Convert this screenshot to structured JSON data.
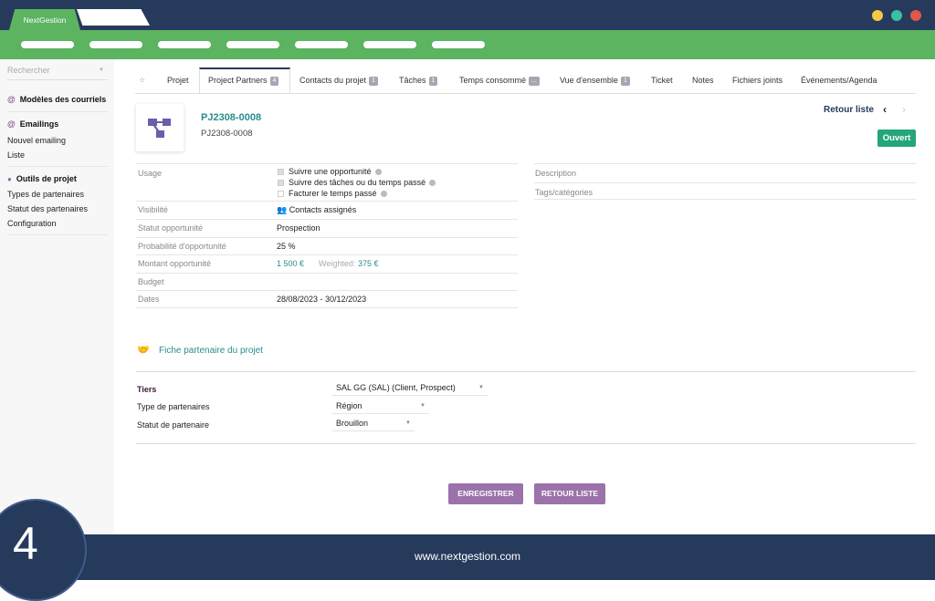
{
  "app": {
    "tab_title": "NextGestion",
    "footer_url": "www.nextgestion.com",
    "step_number": "4",
    "window_dots": [
      "#f6c844",
      "#3cc0a0",
      "#e0584a"
    ]
  },
  "sidebar": {
    "search_placeholder": "Rechercher",
    "sections": [
      {
        "title": "Modèles des courriels",
        "items": []
      },
      {
        "title": "Emailings",
        "items": [
          "Nouvel emailing",
          "Liste"
        ]
      },
      {
        "title": "Outils de projet",
        "items": [
          "Types de partenaires",
          "Statut des partenaires",
          "Configuration"
        ]
      }
    ]
  },
  "tabs": [
    {
      "label": "Projet"
    },
    {
      "label": "Project Partners",
      "badge": "4"
    },
    {
      "label": "Contacts du projet",
      "badge": "1"
    },
    {
      "label": "Tâches",
      "badge": "1"
    },
    {
      "label": "Temps consommé",
      "badge": "..."
    },
    {
      "label": "Vue d'ensemble",
      "badge": "1"
    },
    {
      "label": "Ticket"
    },
    {
      "label": "Notes"
    },
    {
      "label": "Fichiers joints"
    },
    {
      "label": "Événements/Agenda"
    }
  ],
  "project": {
    "ref": "PJ2308-0008",
    "label": "PJ2308-0008",
    "back_link": "Retour liste",
    "status": "Ouvert"
  },
  "fields": {
    "usage_label": "Usage",
    "usage_options": [
      {
        "label": "Suivre une opportunité",
        "checked": true
      },
      {
        "label": "Suivre des tâches ou du temps passé",
        "checked": true
      },
      {
        "label": "Facturer le temps passé",
        "checked": false
      }
    ],
    "visibility_label": "Visibilité",
    "visibility_value": "Contacts assignés",
    "opp_status_label": "Statut opportunité",
    "opp_status_value": "Prospection",
    "prob_label": "Probabilité d'opportunité",
    "prob_value": "25 %",
    "amount_label": "Montant opportunité",
    "amount_value": "1 500 €",
    "weighted_label": "Weighted:",
    "weighted_value": "375 €",
    "budget_label": "Budget",
    "dates_label": "Dates",
    "dates_value": "28/08/2023 - 30/12/2023",
    "description_label": "Description",
    "tags_label": "Tags/catégories"
  },
  "partner": {
    "section_title": "Fiche partenaire du projet",
    "tiers_label": "Tiers",
    "tiers_value": "SAL GG (SAL) (Client, Prospect)",
    "type_label": "Type de partenaires",
    "type_value": "Région",
    "status_label": "Statut de partenaire",
    "status_value": "Brouillon"
  },
  "buttons": {
    "save": "ENREGISTRER",
    "back": "RETOUR LISTE"
  }
}
